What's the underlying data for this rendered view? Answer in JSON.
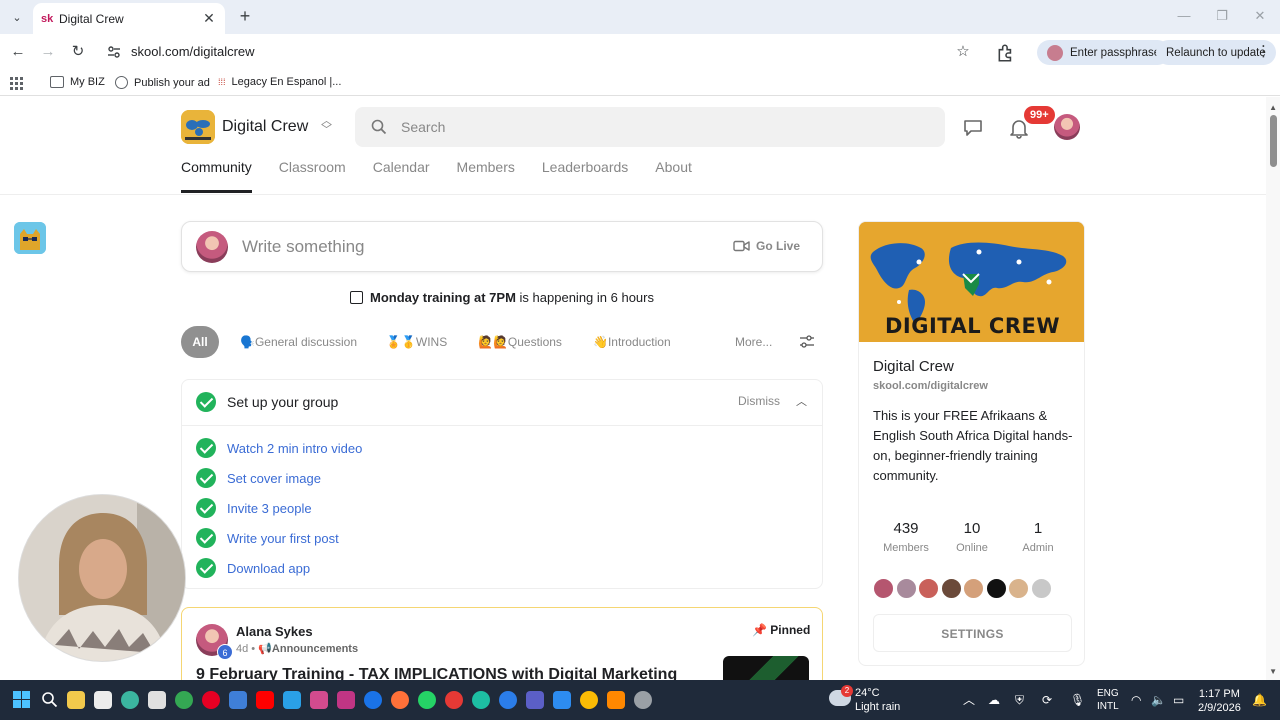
{
  "browser": {
    "tab_title": "Digital Crew",
    "tab_favicon": "sk",
    "url": "skool.com/digitalcrew",
    "passphrase_label": "Enter passphrase",
    "relaunch_label": "Relaunch to update",
    "bookmarks": [
      {
        "label": "My BIZ",
        "icon": "folder-icon"
      },
      {
        "label": "Publish your ad",
        "icon": "globe-icon"
      },
      {
        "label": "Legacy En Espanol |...",
        "icon": "legacy-icon"
      }
    ]
  },
  "header": {
    "group_name": "Digital Crew",
    "search_placeholder": "Search",
    "notification_count": "99+"
  },
  "nav_tabs": [
    "Community",
    "Classroom",
    "Calendar",
    "Members",
    "Leaderboards",
    "About"
  ],
  "composer": {
    "placeholder": "Write something",
    "go_live": "Go Live"
  },
  "event": {
    "name": "Monday training at 7PM",
    "suffix": "is happening in 6 hours"
  },
  "filters": {
    "all": "All",
    "chips": [
      "🗣️General discussion",
      "🏅🥇WINS",
      "🙋🙋Questions",
      "👋Introduction"
    ],
    "more": "More..."
  },
  "setup": {
    "title": "Set up your group",
    "dismiss": "Dismiss",
    "tasks": [
      "Watch 2 min intro video",
      "Set cover image",
      "Invite 3 people",
      "Write your first post",
      "Download app"
    ]
  },
  "post": {
    "author": "Alana Sykes",
    "level": "6",
    "time": "4d",
    "category": "📢Announcements",
    "pinned": "Pinned",
    "title": "9 February Training - TAX IMPLICATIONS with Digital Marketing"
  },
  "about": {
    "cover_text": "DIGITAL CREW",
    "name": "Digital Crew",
    "url": "skool.com/digitalcrew",
    "description": "This is your FREE Afrikaans & English South Africa Digital hands-on, beginner-friendly training community.",
    "stats": [
      {
        "value": "439",
        "label": "Members"
      },
      {
        "value": "10",
        "label": "Online"
      },
      {
        "value": "1",
        "label": "Admin"
      }
    ],
    "settings_label": "SETTINGS",
    "face_colors": [
      "#b5566f",
      "#a88a9c",
      "#c9605a",
      "#6b4a3a",
      "#d4a07a",
      "#111111",
      "#d9b38c",
      "#c8c8c8"
    ]
  },
  "taskbar": {
    "weather_badge": "2",
    "temperature": "24°C",
    "weather": "Light rain",
    "lang_1": "ENG",
    "lang_2": "INTL",
    "time": "1:17 PM",
    "date": "2/9/2026"
  },
  "colors": {
    "accent_green": "#21b35b",
    "link_blue": "#3b6cd5",
    "badge_red": "#e53935",
    "cover_gold": "#e6a62e"
  }
}
